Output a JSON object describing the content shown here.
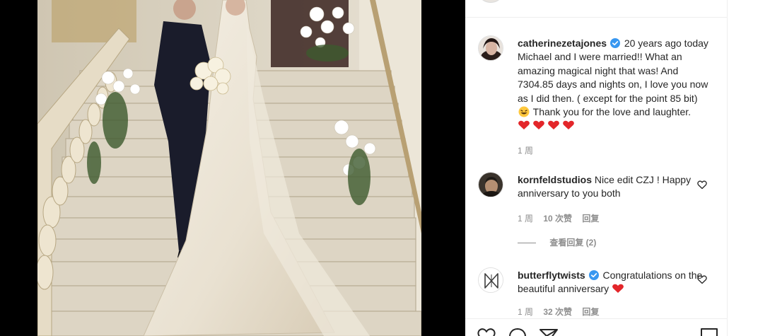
{
  "caption": {
    "username": "catherinezetajones",
    "text": "20 years ago today Michael and I were married!! What an amazing magical night that was! And 7304.85 days and nights on, I love you now as I did then. ( except for the point 85 bit)",
    "text_after_emoji": "Thank you for the love and laughter.",
    "time": "1 周"
  },
  "comments": [
    {
      "username": "kornfeldstudios",
      "text": "Nice edit CZJ ! Happy anniversary to you both",
      "time": "1 周",
      "likes": "10 次赞",
      "reply": "回复",
      "view_replies": "查看回复 (2)"
    },
    {
      "username": "butterflytwists",
      "text": "Congratulations on the beautiful anniversary",
      "time": "1 周",
      "likes": "32 次赞",
      "reply": "回复"
    }
  ],
  "colors": {
    "verified": "#3897f0",
    "heart_emoji": "#e3262a",
    "meta_text": "#8e8e8e",
    "border": "#efefef"
  },
  "icons": [
    "verified-badge-icon",
    "laughing-emoji-icon",
    "red-heart-emoji-icon",
    "heart-outline-icon",
    "comment-icon",
    "share-icon",
    "bookmark-icon"
  ]
}
